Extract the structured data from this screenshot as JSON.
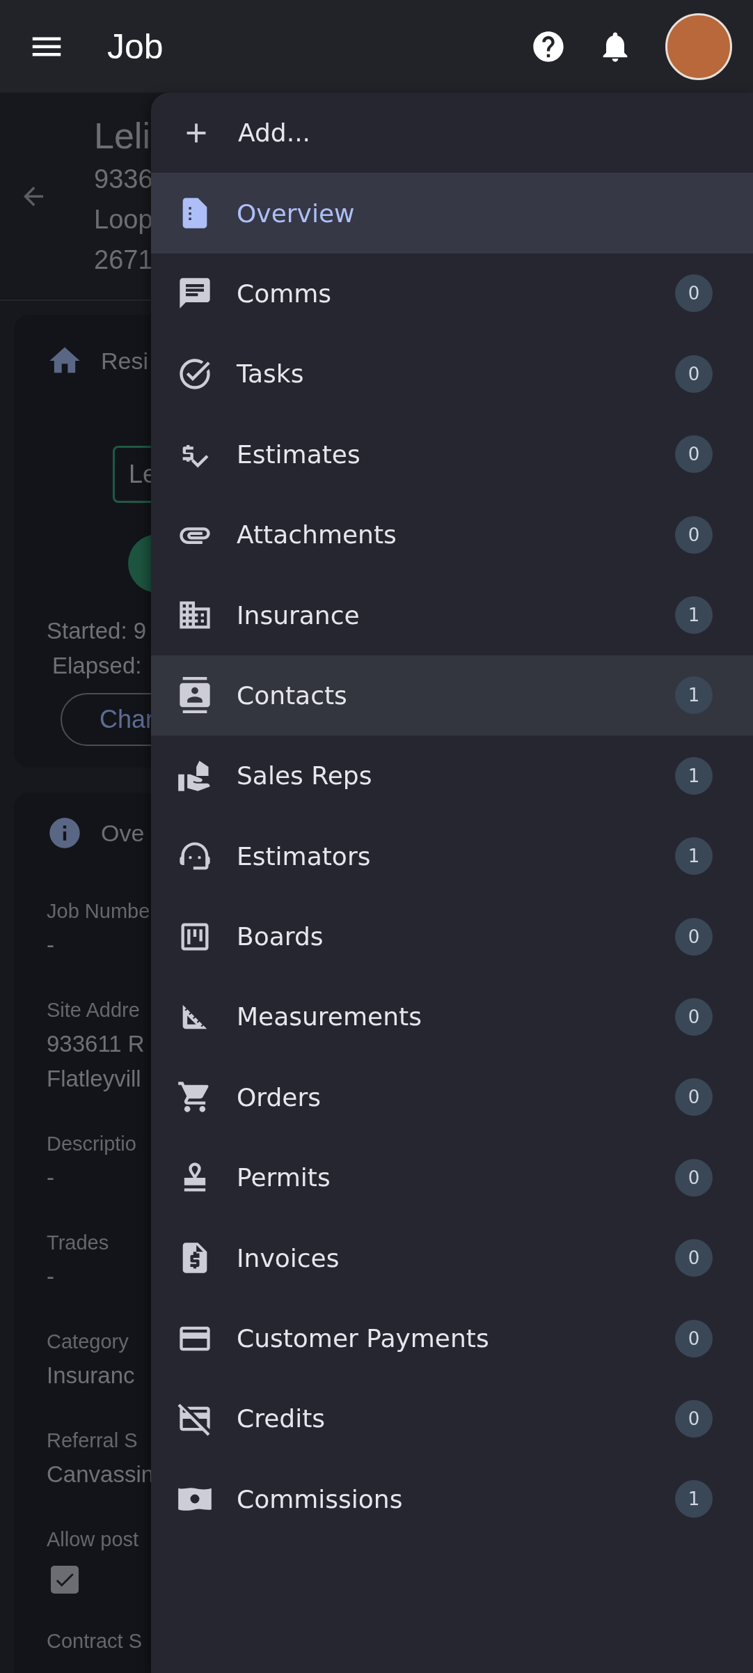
{
  "app_bar": {
    "title": "Job"
  },
  "job_header": {
    "name": "Leli",
    "lines": [
      "9336",
      "Loop",
      "2671"
    ]
  },
  "status_card": {
    "title": "Resi",
    "chip": "Le",
    "started": "Started: 9",
    "elapsed": "Elapsed:",
    "button": "Char"
  },
  "overview_card": {
    "title": "Ove",
    "fields": [
      {
        "kind": "text",
        "label": "Job Numbe",
        "lines": [
          "-"
        ]
      },
      {
        "kind": "text",
        "label": "Site Addre",
        "lines": [
          "933611 R",
          "Flatleyvill"
        ]
      },
      {
        "kind": "text",
        "label": "Descriptio",
        "lines": [
          "-"
        ]
      },
      {
        "kind": "text",
        "label": "Trades",
        "lines": [
          "-"
        ]
      },
      {
        "kind": "text",
        "label": "Category",
        "lines": [
          "Insuranc"
        ]
      },
      {
        "kind": "text",
        "label": "Referral S",
        "lines": [
          "Canvassin"
        ]
      },
      {
        "kind": "checkbox",
        "label": "Allow post",
        "checked": true
      },
      {
        "kind": "text",
        "label": "Contract S"
      }
    ]
  },
  "menu": {
    "add": "Add...",
    "items": [
      {
        "label": "Overview",
        "selected": true,
        "highlighted": false
      },
      {
        "label": "Comms",
        "count": "0",
        "selected": false,
        "highlighted": false
      },
      {
        "label": "Tasks",
        "count": "0",
        "selected": false,
        "highlighted": false
      },
      {
        "label": "Estimates",
        "count": "0",
        "selected": false,
        "highlighted": false
      },
      {
        "label": "Attachments",
        "count": "0",
        "selected": false,
        "highlighted": false
      },
      {
        "label": "Insurance",
        "count": "1",
        "selected": false,
        "highlighted": false
      },
      {
        "label": "Contacts",
        "count": "1",
        "selected": false,
        "highlighted": true
      },
      {
        "label": "Sales Reps",
        "count": "1",
        "selected": false,
        "highlighted": false
      },
      {
        "label": "Estimators",
        "count": "1",
        "selected": false,
        "highlighted": false
      },
      {
        "label": "Boards",
        "count": "0",
        "selected": false,
        "highlighted": false
      },
      {
        "label": "Measurements",
        "count": "0",
        "selected": false,
        "highlighted": false
      },
      {
        "label": "Orders",
        "count": "0",
        "selected": false,
        "highlighted": false
      },
      {
        "label": "Permits",
        "count": "0",
        "selected": false,
        "highlighted": false
      },
      {
        "label": "Invoices",
        "count": "0",
        "selected": false,
        "highlighted": false
      },
      {
        "label": "Customer Payments",
        "count": "0",
        "selected": false,
        "highlighted": false
      },
      {
        "label": "Credits",
        "count": "0",
        "selected": false,
        "highlighted": false
      },
      {
        "label": "Commissions",
        "count": "1",
        "selected": false,
        "highlighted": false
      }
    ]
  }
}
